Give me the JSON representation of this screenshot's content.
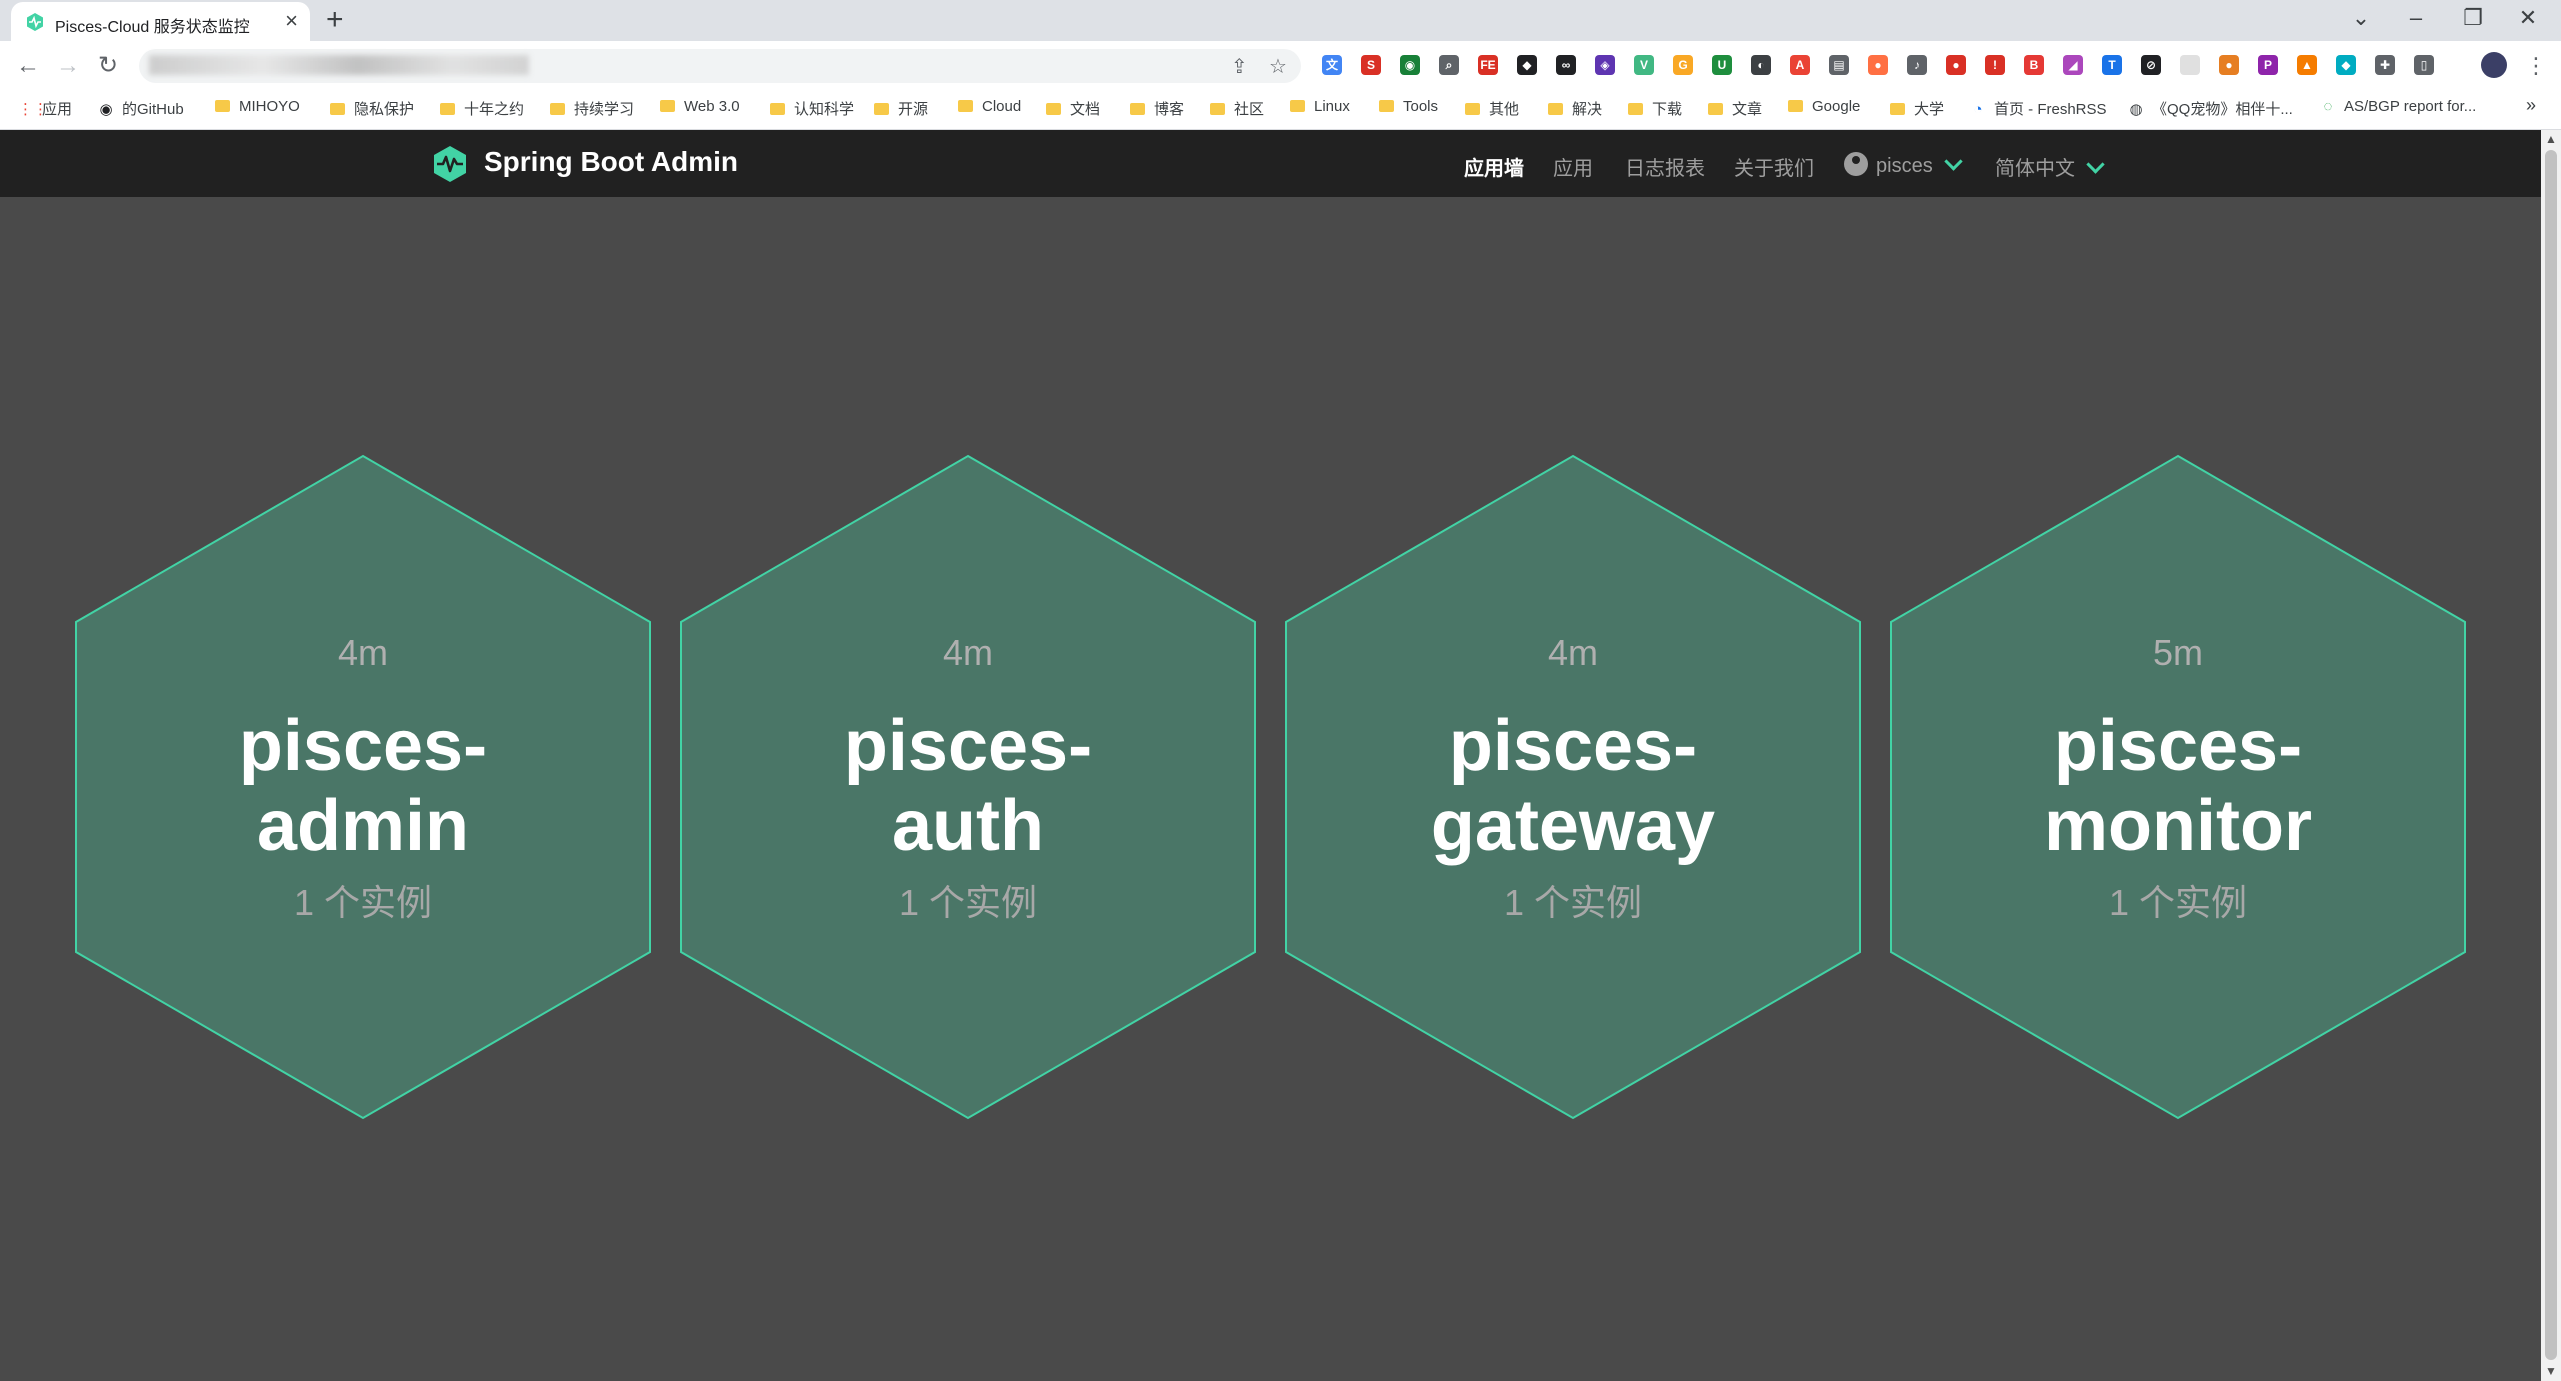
{
  "browser": {
    "tab_title": "Pisces-Cloud 服务状态监控",
    "tab_close": "×",
    "new_tab": "+",
    "window_controls": [
      "⌄",
      "–",
      "❐",
      "✕"
    ],
    "omnibox_icons": [
      "share-icon",
      "star-icon"
    ],
    "extensions": [
      {
        "name": "translate-ext",
        "color": "#4285f4",
        "glyph": "文"
      },
      {
        "name": "s-ext",
        "color": "#d93025",
        "glyph": "S"
      },
      {
        "name": "globe-ext",
        "color": "#188038",
        "glyph": "◉"
      },
      {
        "name": "link-ext",
        "color": "#5f6368",
        "glyph": "⌕"
      },
      {
        "name": "fe-ext",
        "color": "#d93025",
        "glyph": "FE"
      },
      {
        "name": "cube-ext",
        "color": "#202124",
        "glyph": "◆"
      },
      {
        "name": "glasses-ext",
        "color": "#202124",
        "glyph": "∞"
      },
      {
        "name": "purple-ext",
        "color": "#5e35b1",
        "glyph": "◈"
      },
      {
        "name": "vue-ext",
        "color": "#41b883",
        "glyph": "V"
      },
      {
        "name": "g-ext",
        "color": "#f9a825",
        "glyph": "G"
      },
      {
        "name": "u-ext",
        "color": "#1e8e3e",
        "glyph": "U"
      },
      {
        "name": "dark-ext",
        "color": "#3c4043",
        "glyph": "◐"
      },
      {
        "name": "a-ext",
        "color": "#ea4335",
        "glyph": "A"
      },
      {
        "name": "mute-ext",
        "color": "#5f6368",
        "glyph": "▤"
      },
      {
        "name": "orange-ext",
        "color": "#ff7043",
        "glyph": "●"
      },
      {
        "name": "mic-ext",
        "color": "#5f6368",
        "glyph": "♪"
      },
      {
        "name": "red-ext",
        "color": "#d93025",
        "glyph": "●"
      },
      {
        "name": "alert-ext",
        "color": "#d93025",
        "glyph": "!"
      },
      {
        "name": "b-ext",
        "color": "#e53935",
        "glyph": "B"
      },
      {
        "name": "cursor-ext",
        "color": "#ab47bc",
        "glyph": "◢"
      },
      {
        "name": "t-ext",
        "color": "#1a73e8",
        "glyph": "T"
      },
      {
        "name": "block-ext",
        "color": "#202124",
        "glyph": "⊘"
      },
      {
        "name": "blank-ext",
        "color": "#e0e0e0",
        "glyph": ""
      },
      {
        "name": "cookie-ext",
        "color": "#e67e22",
        "glyph": "●"
      },
      {
        "name": "pdf-ext",
        "color": "#8e24aa",
        "glyph": "P"
      },
      {
        "name": "fox-ext",
        "color": "#f57c00",
        "glyph": "▲"
      },
      {
        "name": "shield-ext",
        "color": "#00acc1",
        "glyph": "◆"
      },
      {
        "name": "puzzle-ext",
        "color": "#5f6368",
        "glyph": "✚"
      },
      {
        "name": "sidebar-ext",
        "color": "#5f6368",
        "glyph": "▯"
      }
    ],
    "bookmarks": [
      {
        "label": "应用",
        "kind": "apps"
      },
      {
        "label": "的GitHub",
        "kind": "github"
      },
      {
        "label": "MIHOYO",
        "kind": "folder"
      },
      {
        "label": "隐私保护",
        "kind": "folder"
      },
      {
        "label": "十年之约",
        "kind": "folder"
      },
      {
        "label": "持续学习",
        "kind": "folder"
      },
      {
        "label": "Web 3.0",
        "kind": "folder"
      },
      {
        "label": "认知科学",
        "kind": "folder"
      },
      {
        "label": "开源",
        "kind": "folder"
      },
      {
        "label": "Cloud",
        "kind": "folder"
      },
      {
        "label": "文档",
        "kind": "folder"
      },
      {
        "label": "博客",
        "kind": "folder"
      },
      {
        "label": "社区",
        "kind": "folder"
      },
      {
        "label": "Linux",
        "kind": "folder"
      },
      {
        "label": "Tools",
        "kind": "folder"
      },
      {
        "label": "其他",
        "kind": "folder"
      },
      {
        "label": "解决",
        "kind": "folder"
      },
      {
        "label": "下载",
        "kind": "folder"
      },
      {
        "label": "文章",
        "kind": "folder"
      },
      {
        "label": "Google",
        "kind": "folder"
      },
      {
        "label": "大学",
        "kind": "folder"
      },
      {
        "label": "首页 - FreshRSS",
        "kind": "rss"
      },
      {
        "label": "《QQ宠物》相伴十...",
        "kind": "globe"
      },
      {
        "label": "AS/BGP report for...",
        "kind": "bgp"
      }
    ],
    "bookmarks_overflow": "»"
  },
  "app": {
    "brand": "Spring Boot Admin",
    "accent_color": "#42d3a5",
    "nav": [
      {
        "label": "应用墙",
        "active": true
      },
      {
        "label": "应用",
        "active": false
      },
      {
        "label": "日志报表",
        "active": false
      },
      {
        "label": "关于我们",
        "active": false
      }
    ],
    "user": "pisces",
    "language": "简体中文",
    "applications": [
      {
        "uptime": "4m",
        "name_line1": "pisces-",
        "name_line2": "admin",
        "instances": "1 个实例"
      },
      {
        "uptime": "4m",
        "name_line1": "pisces-",
        "name_line2": "auth",
        "instances": "1 个实例"
      },
      {
        "uptime": "4m",
        "name_line1": "pisces-",
        "name_line2": "gateway",
        "instances": "1 个实例"
      },
      {
        "uptime": "5m",
        "name_line1": "pisces-",
        "name_line2": "monitor",
        "instances": "1 个实例"
      }
    ]
  }
}
